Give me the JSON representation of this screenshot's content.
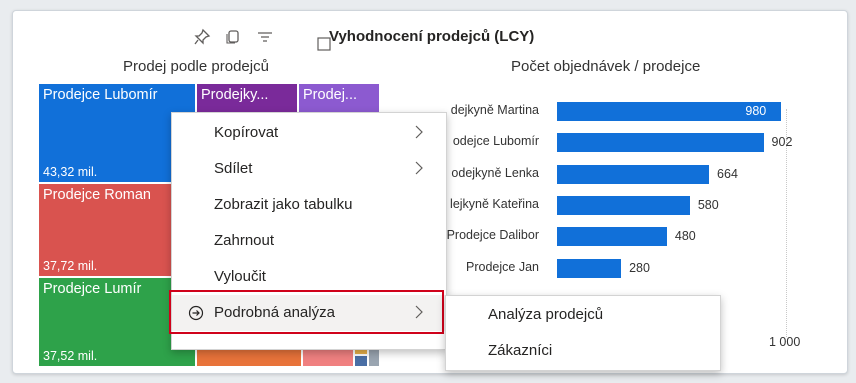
{
  "visual": {
    "title": "Vyhodnocení prodejců (LCY)",
    "header_icons": [
      "pin-icon",
      "copy-visual-icon",
      "filter-icon"
    ]
  },
  "treemap": {
    "title": "Prodej podle prodejců",
    "tiles": [
      {
        "label": "Prodejce Lubomír",
        "value": "43,32 mil.",
        "color": "#1170d9"
      },
      {
        "label": "Prodejky...",
        "value": "",
        "color": "#7a2a9a"
      },
      {
        "label": "Prodej...",
        "value": "",
        "color": "#8c5ad0"
      },
      {
        "label": "Prodejce Roman",
        "value": "37,72 mil.",
        "color": "#d9534f"
      },
      {
        "label": "Prodejce Lumír",
        "value": "37,52 mil.",
        "color": "#2ea24a"
      }
    ],
    "colors": {
      "orange": "#e8733a",
      "pink": "#f08080"
    }
  },
  "bar_chart": {
    "title": "Počet objednávek / prodejce",
    "axis_tick": "1 000"
  },
  "chart_data": {
    "type": "bar",
    "title": "Počet objednávek / prodejce",
    "orientation": "horizontal",
    "categories": [
      "Prodejkyně Martina",
      "Prodejce Lubomír",
      "Prodejkyně Lenka",
      "Prodejkyně Kateřina",
      "Prodejce Dalibor",
      "Prodejce Jan"
    ],
    "visible_labels": [
      "dejkyně Martina",
      "odejce Lubomír",
      "odejkyně Lenka",
      "lejkyně Kateřina",
      "Prodejce Dalibor",
      "Prodejce Jan"
    ],
    "values": [
      980,
      902,
      664,
      580,
      480,
      280
    ],
    "xlim": [
      0,
      1100
    ],
    "xticks": [
      1000
    ],
    "color": "#1170d9",
    "grid": true
  },
  "context_menu": {
    "items": [
      {
        "label": "Kopírovat",
        "submenu": true
      },
      {
        "label": "Sdílet",
        "submenu": true
      },
      {
        "label": "Zobrazit jako tabulku",
        "submenu": false
      },
      {
        "label": "Zahrnout",
        "submenu": false
      },
      {
        "label": "Vyloučit",
        "submenu": false
      },
      {
        "label": "Podrobná analýza",
        "submenu": true,
        "highlighted": true
      }
    ]
  },
  "submenu": {
    "items": [
      "Analýza prodejců",
      "Zákazníci"
    ]
  }
}
